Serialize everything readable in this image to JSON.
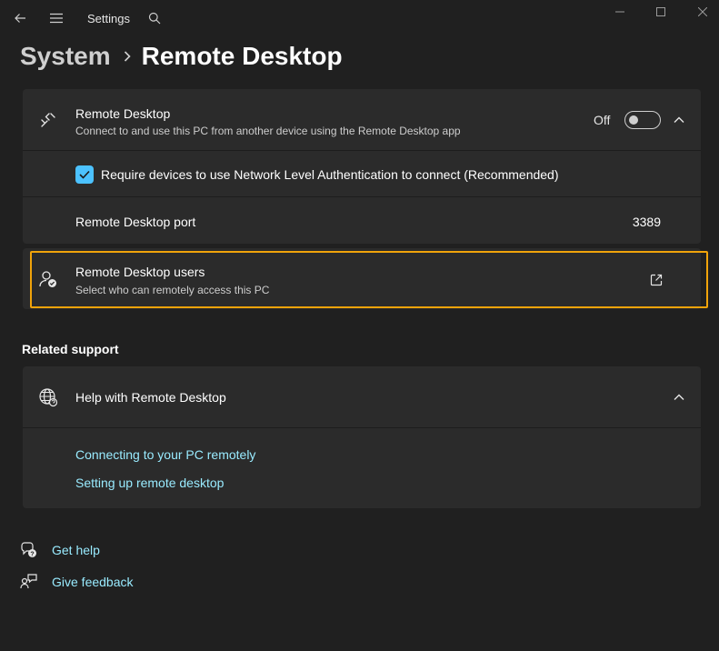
{
  "window": {
    "app_title": "Settings",
    "icons": {
      "back": "back-arrow-icon",
      "menu": "hamburger-icon",
      "search": "search-icon",
      "minimize": "minimize-icon",
      "maximize": "maximize-icon",
      "close": "close-icon"
    }
  },
  "breadcrumb": {
    "parent": "System",
    "current": "Remote Desktop"
  },
  "remote_desktop": {
    "title": "Remote Desktop",
    "subtitle": "Connect to and use this PC from another device using the Remote Desktop app",
    "toggle_label": "Off",
    "toggle_on": false,
    "nla_label": "Require devices to use Network Level Authentication to connect (Recommended)",
    "nla_checked": true,
    "port_label": "Remote Desktop port",
    "port_value": "3389"
  },
  "users": {
    "title": "Remote Desktop users",
    "subtitle": "Select who can remotely access this PC"
  },
  "related_support": {
    "heading": "Related support",
    "help_title": "Help with Remote Desktop",
    "links": [
      "Connecting to your PC remotely",
      "Setting up remote desktop"
    ]
  },
  "footer": {
    "get_help": "Get help",
    "give_feedback": "Give feedback"
  },
  "colors": {
    "background": "#202020",
    "card": "#2b2b2b",
    "accent": "#4cc2ff",
    "link": "#99ebff",
    "focus": "#f0a30a"
  }
}
